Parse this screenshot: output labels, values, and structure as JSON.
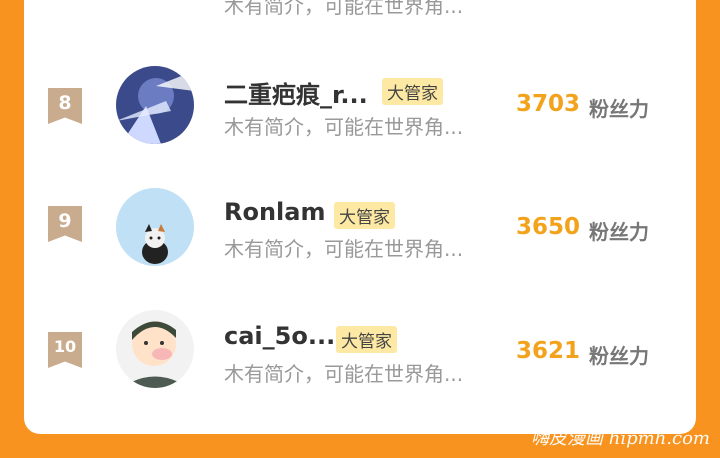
{
  "top_partial": {
    "bio": "木有简介，可能在世界角..."
  },
  "rows": [
    {
      "rank": "8",
      "name": "二重疤痕_r...",
      "tag": "大管家",
      "bio": "木有简介，可能在世界角...",
      "score": "3703",
      "score_label": "粉丝力"
    },
    {
      "rank": "9",
      "name": "Ronlam",
      "tag": "大管家",
      "bio": "木有简介，可能在世界角...",
      "score": "3650",
      "score_label": "粉丝力"
    },
    {
      "rank": "10",
      "name": "cai_5o...",
      "tag": "大管家",
      "bio": "木有简介，可能在世界角...",
      "score": "3621",
      "score_label": "粉丝力"
    }
  ],
  "watermark": "嗨皮漫画 hipmh.com",
  "colors": {
    "background": "#f7931e",
    "score": "#f3a21b",
    "tag_bg": "#fde9a4",
    "rank_badge": "#c9ab8e"
  }
}
